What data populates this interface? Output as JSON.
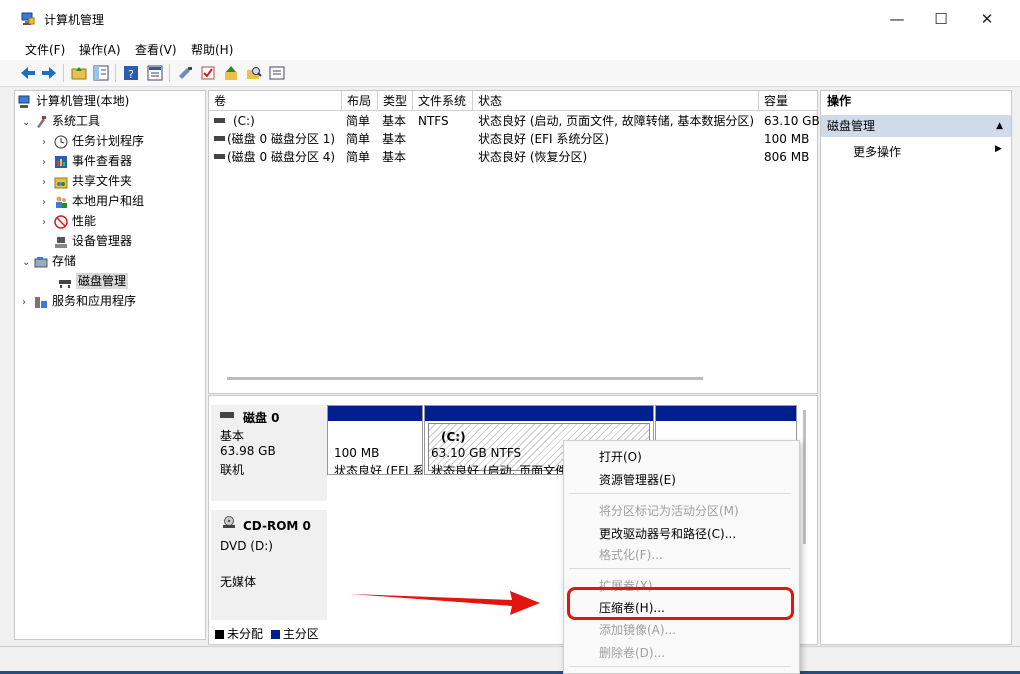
{
  "window": {
    "title": "计算机管理",
    "minimize": "—",
    "maximize": "☐",
    "close": "✕"
  },
  "menu": [
    "文件(F)",
    "操作(A)",
    "查看(V)",
    "帮助(H)"
  ],
  "tree": {
    "root": "计算机管理(本地)",
    "system_tools": "系统工具",
    "task_scheduler": "任务计划程序",
    "event_viewer": "事件查看器",
    "shared_folders": "共享文件夹",
    "local_users": "本地用户和组",
    "performance": "性能",
    "device_manager": "设备管理器",
    "storage": "存储",
    "disk_management": "磁盘管理",
    "services_apps": "服务和应用程序"
  },
  "columns": [
    "卷",
    "布局",
    "类型",
    "文件系统",
    "状态",
    "容量"
  ],
  "volumes": [
    {
      "name": "(C:)",
      "layout": "简单",
      "type": "基本",
      "fs": "NTFS",
      "status": "状态良好 (启动, 页面文件, 故障转储, 基本数据分区)",
      "capacity": "63.10 GB"
    },
    {
      "name": "(磁盘 0 磁盘分区 1)",
      "layout": "简单",
      "type": "基本",
      "fs": "",
      "status": "状态良好 (EFI 系统分区)",
      "capacity": "100 MB"
    },
    {
      "name": "(磁盘 0 磁盘分区 4)",
      "layout": "简单",
      "type": "基本",
      "fs": "",
      "status": "状态良好 (恢复分区)",
      "capacity": "806 MB"
    }
  ],
  "disk0": {
    "name": "磁盘 0",
    "type": "基本",
    "size": "63.98 GB",
    "state": "联机",
    "p1_size": "100 MB",
    "p1_status": "状态良好 (EFI 系",
    "p2_label": "(C:)",
    "p2_size": "63.10 GB NTFS",
    "p2_status": "状态良好 (启动, 页面文件"
  },
  "cdrom": {
    "name": "CD-ROM 0",
    "drive": "DVD (D:)",
    "media": "无媒体"
  },
  "legend": {
    "unallocated": "未分配",
    "primary": "主分区",
    "unallocated_color": "#000000",
    "primary_color": "#001f8f"
  },
  "actions": {
    "header": "操作",
    "section": "磁盘管理",
    "more": "更多操作",
    "collapse_arrow": "▲",
    "more_arrow": "▶"
  },
  "context_menu": {
    "open": "打开(O)",
    "explorer": "资源管理器(E)",
    "mark_active": "将分区标记为活动分区(M)",
    "change_letter": "更改驱动器号和路径(C)...",
    "format": "格式化(F)...",
    "extend": "扩展卷(X)...",
    "shrink": "压缩卷(H)...",
    "add_mirror": "添加镜像(A)...",
    "delete": "删除卷(D)..."
  },
  "colors": {
    "highlight_box": "#e3150e",
    "arrow": "#e3150e"
  }
}
